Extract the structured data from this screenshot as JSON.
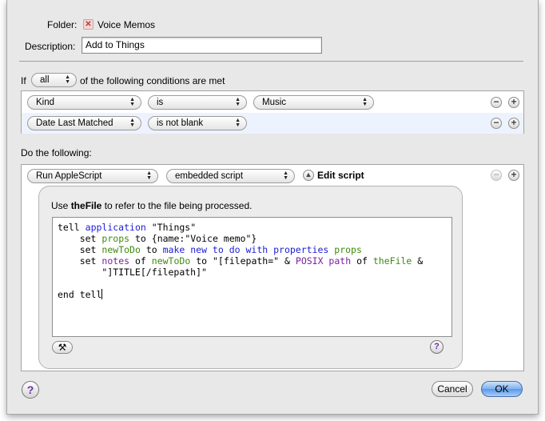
{
  "folder": {
    "label": "Folder:",
    "value": "Voice Memos"
  },
  "description": {
    "label": "Description:",
    "value": "Add to Things"
  },
  "conditions": {
    "prefix": "If",
    "match": "all",
    "suffix": "of the following conditions are met",
    "rows": [
      {
        "attribute": "Kind",
        "operator": "is",
        "value": "Music"
      },
      {
        "attribute": "Date Last Matched",
        "operator": "is not blank"
      }
    ]
  },
  "actions": {
    "heading": "Do the following:",
    "row": {
      "action": "Run AppleScript",
      "source": "embedded script",
      "edit_label": "Edit script"
    }
  },
  "script_panel": {
    "hint_prefix": "Use ",
    "hint_bold": "theFile",
    "hint_suffix": " to refer to the file being processed.",
    "script": {
      "tell": "tell",
      "application": "application",
      "app_name": "\"Things\"",
      "set": "set",
      "props": "props",
      "to": "to",
      "record": "{name:\"Voice memo\"}",
      "newToDo": "newToDo",
      "make_cmd": "make new to do with properties",
      "notes": "notes",
      "of": "of",
      "filepath_str": "\"[filepath=\"",
      "amp": "&",
      "posix": "POSIX path",
      "theFile": "theFile",
      "title_str": "\"]TITLE[/filepath]\"",
      "end_tell": "end tell"
    }
  },
  "buttons": {
    "cancel": "Cancel",
    "ok": "OK",
    "help": "?"
  }
}
